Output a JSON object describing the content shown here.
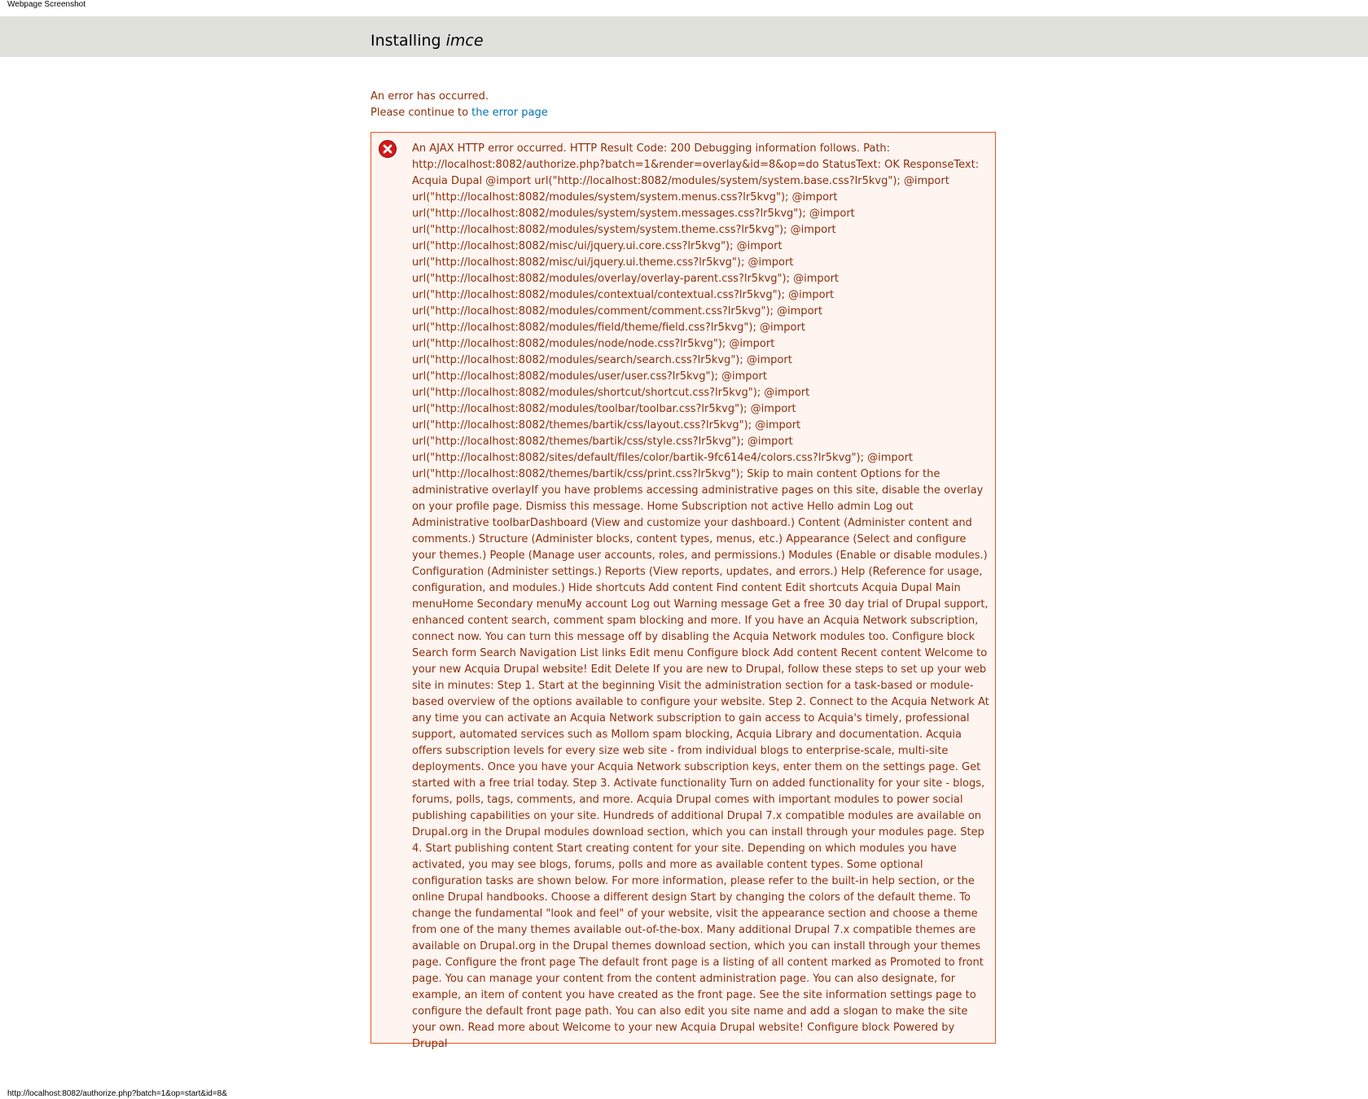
{
  "window": {
    "title": "Webpage Screenshot"
  },
  "header": {
    "title_prefix": "Installing ",
    "title_module": "imce"
  },
  "intro": {
    "error_line": "An error has occurred.",
    "continue_prefix": "Please continue to ",
    "error_page_link": "the error page"
  },
  "error_box": {
    "icon": "error-x-icon",
    "message": "An AJAX HTTP error occurred. HTTP Result Code: 200 Debugging information follows. Path: http://localhost:8082/authorize.php?batch=1&render=overlay&id=8&op=do StatusText: OK ResponseText: Acquia Dupal @import url(\"http://localhost:8082/modules/system/system.base.css?lr5kvg\"); @import url(\"http://localhost:8082/modules/system/system.menus.css?lr5kvg\"); @import url(\"http://localhost:8082/modules/system/system.messages.css?lr5kvg\"); @import url(\"http://localhost:8082/modules/system/system.theme.css?lr5kvg\"); @import url(\"http://localhost:8082/misc/ui/jquery.ui.core.css?lr5kvg\"); @import url(\"http://localhost:8082/misc/ui/jquery.ui.theme.css?lr5kvg\"); @import url(\"http://localhost:8082/modules/overlay/overlay-parent.css?lr5kvg\"); @import url(\"http://localhost:8082/modules/contextual/contextual.css?lr5kvg\"); @import url(\"http://localhost:8082/modules/comment/comment.css?lr5kvg\"); @import url(\"http://localhost:8082/modules/field/theme/field.css?lr5kvg\"); @import url(\"http://localhost:8082/modules/node/node.css?lr5kvg\"); @import url(\"http://localhost:8082/modules/search/search.css?lr5kvg\"); @import url(\"http://localhost:8082/modules/user/user.css?lr5kvg\"); @import url(\"http://localhost:8082/modules/shortcut/shortcut.css?lr5kvg\"); @import url(\"http://localhost:8082/modules/toolbar/toolbar.css?lr5kvg\"); @import url(\"http://localhost:8082/themes/bartik/css/layout.css?lr5kvg\"); @import url(\"http://localhost:8082/themes/bartik/css/style.css?lr5kvg\"); @import url(\"http://localhost:8082/sites/default/files/color/bartik-9fc614e4/colors.css?lr5kvg\"); @import url(\"http://localhost:8082/themes/bartik/css/print.css?lr5kvg\"); Skip to main content Options for the administrative overlayIf you have problems accessing administrative pages on this site, disable the overlay on your profile page. Dismiss this message. Home Subscription not active Hello admin Log out Administrative toolbarDashboard (View and customize your dashboard.) Content (Administer content and comments.) Structure (Administer blocks, content types, menus, etc.) Appearance (Select and configure your themes.) People (Manage user accounts, roles, and permissions.) Modules (Enable or disable modules.) Configuration (Administer settings.) Reports (View reports, updates, and errors.) Help (Reference for usage, configuration, and modules.) Hide shortcuts Add content Find content Edit shortcuts Acquia Dupal Main menuHome Secondary menuMy account Log out Warning message Get a free 30 day trial of Drupal support, enhanced content search, comment spam blocking and more. If you have an Acquia Network subscription, connect now. You can turn this message off by disabling the Acquia Network modules too. Configure block Search form Search Navigation List links Edit menu Configure block Add content Recent content Welcome to your new Acquia Drupal website! Edit Delete If you are new to Drupal, follow these steps to set up your web site in minutes: Step 1. Start at the beginning Visit the administration section for a task-based or module-based overview of the options available to configure your website. Step 2. Connect to the Acquia Network At any time you can activate an Acquia Network subscription to gain access to Acquia's timely, professional support, automated services such as Mollom spam blocking, Acquia Library and documentation. Acquia offers subscription levels for every size web site - from individual blogs to enterprise-scale, multi-site deployments. Once you have your Acquia Network subscription keys, enter them on the settings page. Get started with a free trial today. Step 3. Activate functionality Turn on added functionality for your site - blogs, forums, polls, tags, comments, and more. Acquia Drupal comes with important modules to power social publishing capabilities on your site. Hundreds of additional Drupal 7.x compatible modules are available on Drupal.org in the Drupal modules download section, which you can install through your modules page. Step 4. Start publishing content Start creating content for your site. Depending on which modules you have activated, you may see blogs, forums, polls and more as available content types. Some optional configuration tasks are shown below. For more information, please refer to the built-in help section, or the online Drupal handbooks. Choose a different design Start by changing the colors of the default theme. To change the fundamental \"look and feel\" of your website, visit the appearance section and choose a theme from one of the many themes available out-of-the-box. Many additional Drupal 7.x compatible themes are available on Drupal.org in the Drupal themes download section, which you can install through your themes page. Configure the front page The default front page is a listing of all content marked as Promoted to front page. You can manage your content from the content administration page. You can also designate, for example, an item of content you have created as the front page. See the site information settings page to configure the default front page path. You can also edit you site name and add a slogan to make the site your own. Read more about Welcome to your new Acquia Drupal website! Configure block Powered by Drupal"
  },
  "status_bar": {
    "url": "http://localhost:8082/authorize.php?batch=1&op=start&id=8&"
  },
  "colors": {
    "header_bg": "#e1e1dc",
    "error_text": "#8c2e0b",
    "error_bg": "#fef5f1",
    "error_border": "#ed541d",
    "link": "#0071b3",
    "icon_red": "#d11a1a"
  }
}
